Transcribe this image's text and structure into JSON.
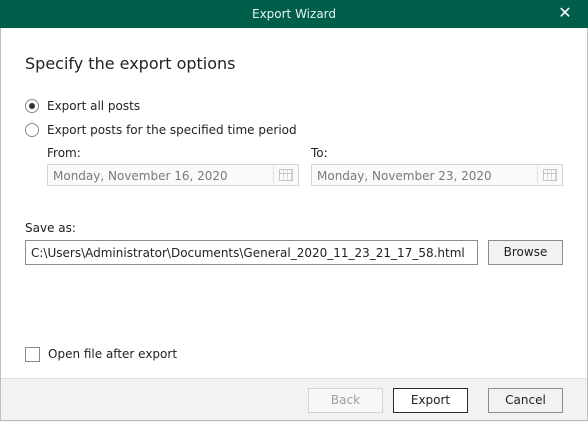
{
  "window": {
    "title": "Export Wizard",
    "close_icon": "close-icon"
  },
  "page": {
    "heading": "Specify the export options"
  },
  "options": {
    "export_all": {
      "label": "Export all posts",
      "checked": true
    },
    "export_period": {
      "label": "Export posts for the specified time period",
      "checked": false
    }
  },
  "period": {
    "from_label": "From:",
    "from_value": "Monday, November 16, 2020",
    "to_label": "To:",
    "to_value": "Monday, November 23, 2020",
    "enabled": false
  },
  "save": {
    "label": "Save as:",
    "path": "C:\\Users\\Administrator\\Documents\\General_2020_11_23_21_17_58.html",
    "browse_label": "Browse"
  },
  "open_after": {
    "label": "Open file after export",
    "checked": false
  },
  "footer": {
    "back_label": "Back",
    "export_label": "Export",
    "cancel_label": "Cancel"
  },
  "colors": {
    "titlebar": "#005f4b",
    "footer": "#f2f2f2"
  }
}
